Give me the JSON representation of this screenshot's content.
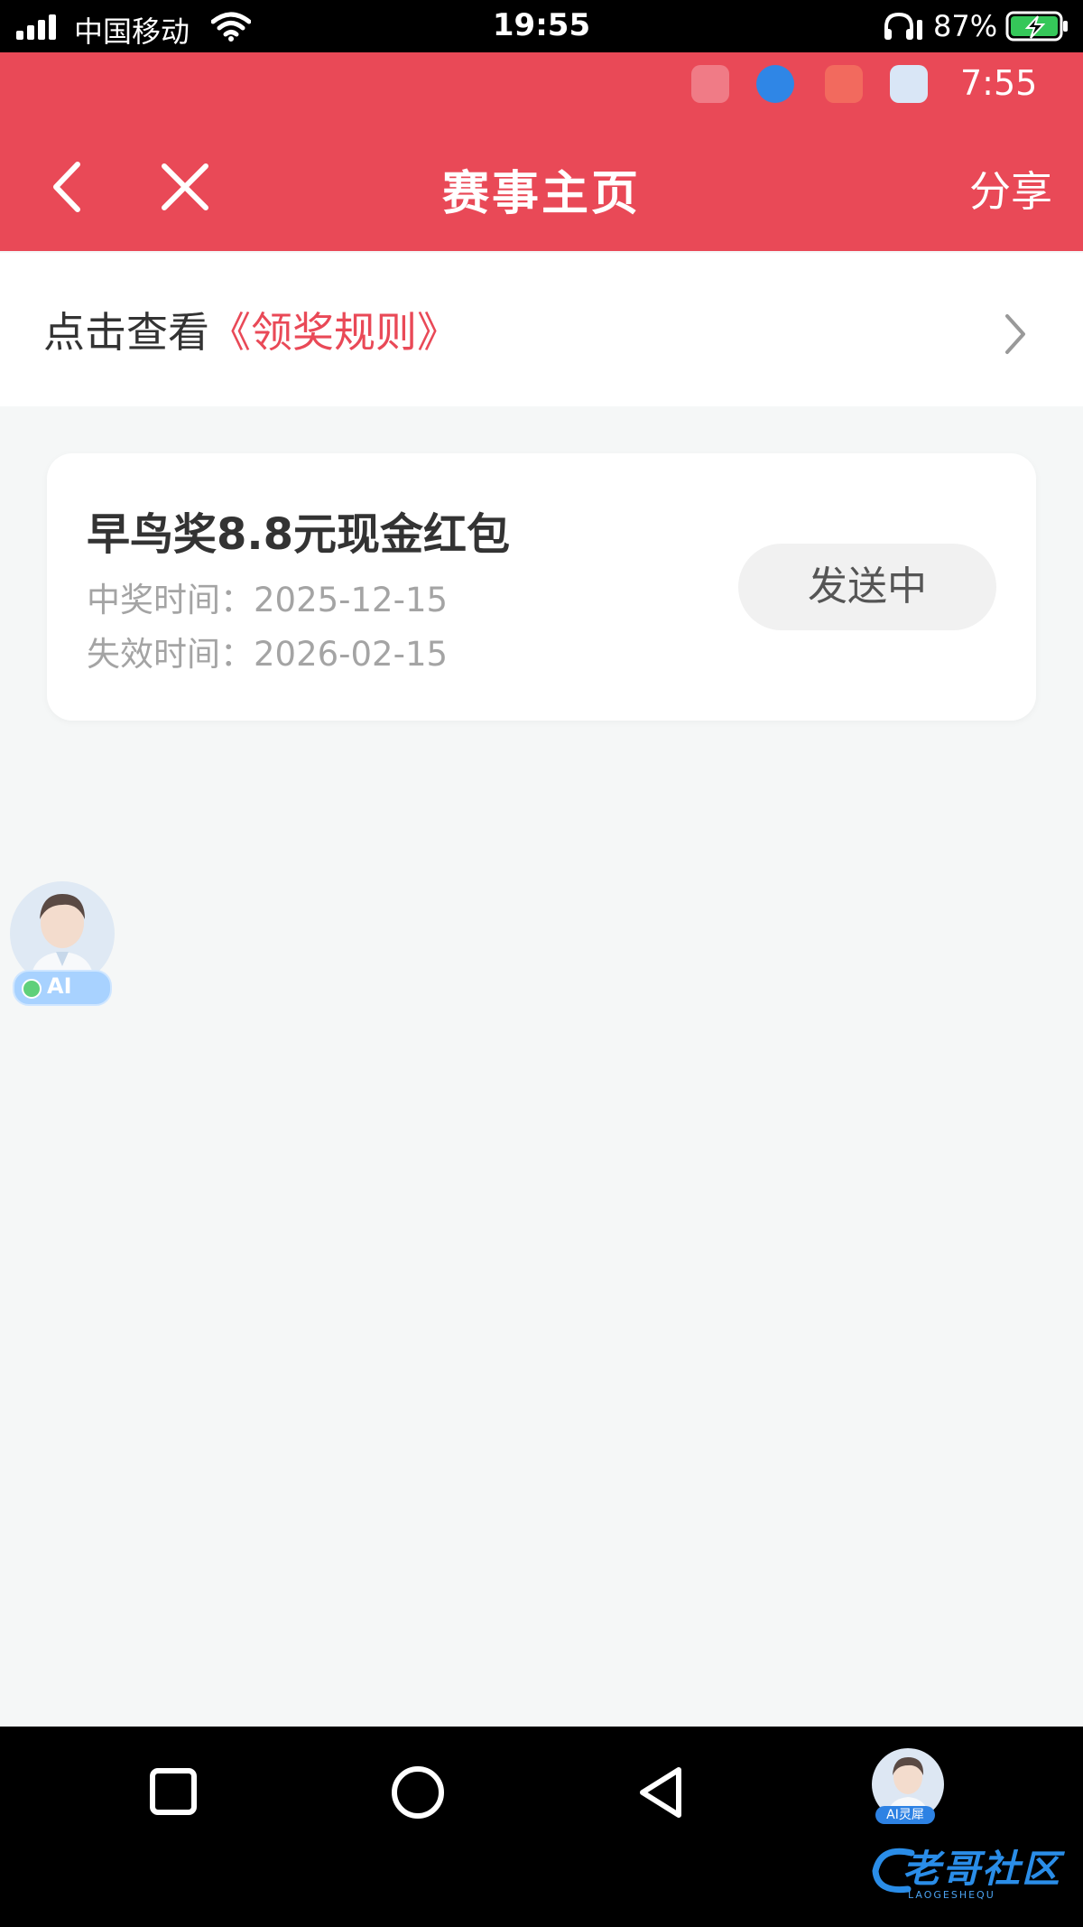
{
  "status_bar": {
    "carrier": "中国移动",
    "time": "19:55",
    "battery_percent": "87%"
  },
  "header": {
    "inner_time": "7:55",
    "title": "赛事主页",
    "share_label": "分享",
    "color": "#e94957"
  },
  "rules": {
    "prefix": "点击查看",
    "link": "《领奖规则》"
  },
  "prize_card": {
    "title": "早鸟奖8.8元现金红包",
    "win_time": "中奖时间：2025-12-15",
    "expire_time": "失效时间：2026-02-15",
    "status_button": "发送中"
  },
  "ai_assistant": {
    "float_label": "AI",
    "nav_label": "AI灵犀"
  },
  "watermark": {
    "text": "老哥社区",
    "sub": "LAOGESHEQU"
  },
  "icons": [
    "signal-icon",
    "wifi-icon",
    "headphone-icon",
    "battery-charging-icon",
    "back-icon",
    "close-icon",
    "chevron-right-icon",
    "square-nav-icon",
    "circle-nav-icon",
    "triangle-nav-icon"
  ]
}
